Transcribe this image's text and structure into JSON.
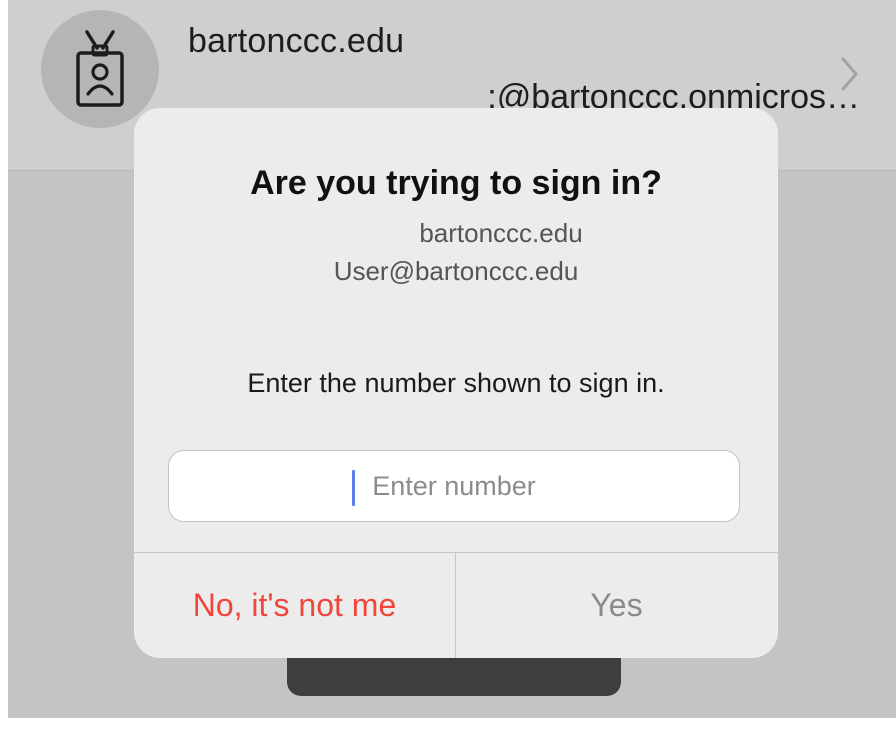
{
  "account": {
    "title": "bartonccc.edu",
    "email": ":@bartonccc.onmicros…",
    "avatar_icon": "id-badge-icon",
    "chevron_icon": "chevron-right-icon"
  },
  "dialog": {
    "title": "Are you trying to sign in?",
    "org": "bartonccc.edu",
    "user": "User@bartonccc.edu",
    "instruction": "Enter the number shown to sign in.",
    "input_value": "",
    "input_placeholder": "Enter number",
    "deny_label": "No, it's not me",
    "approve_label": "Yes"
  },
  "colors": {
    "deny": "#f0463b",
    "approve_disabled": "#8a8a8a",
    "caret": "#5b7fe8",
    "dialog_bg": "#ececec",
    "backdrop": "#c4c4c4"
  }
}
